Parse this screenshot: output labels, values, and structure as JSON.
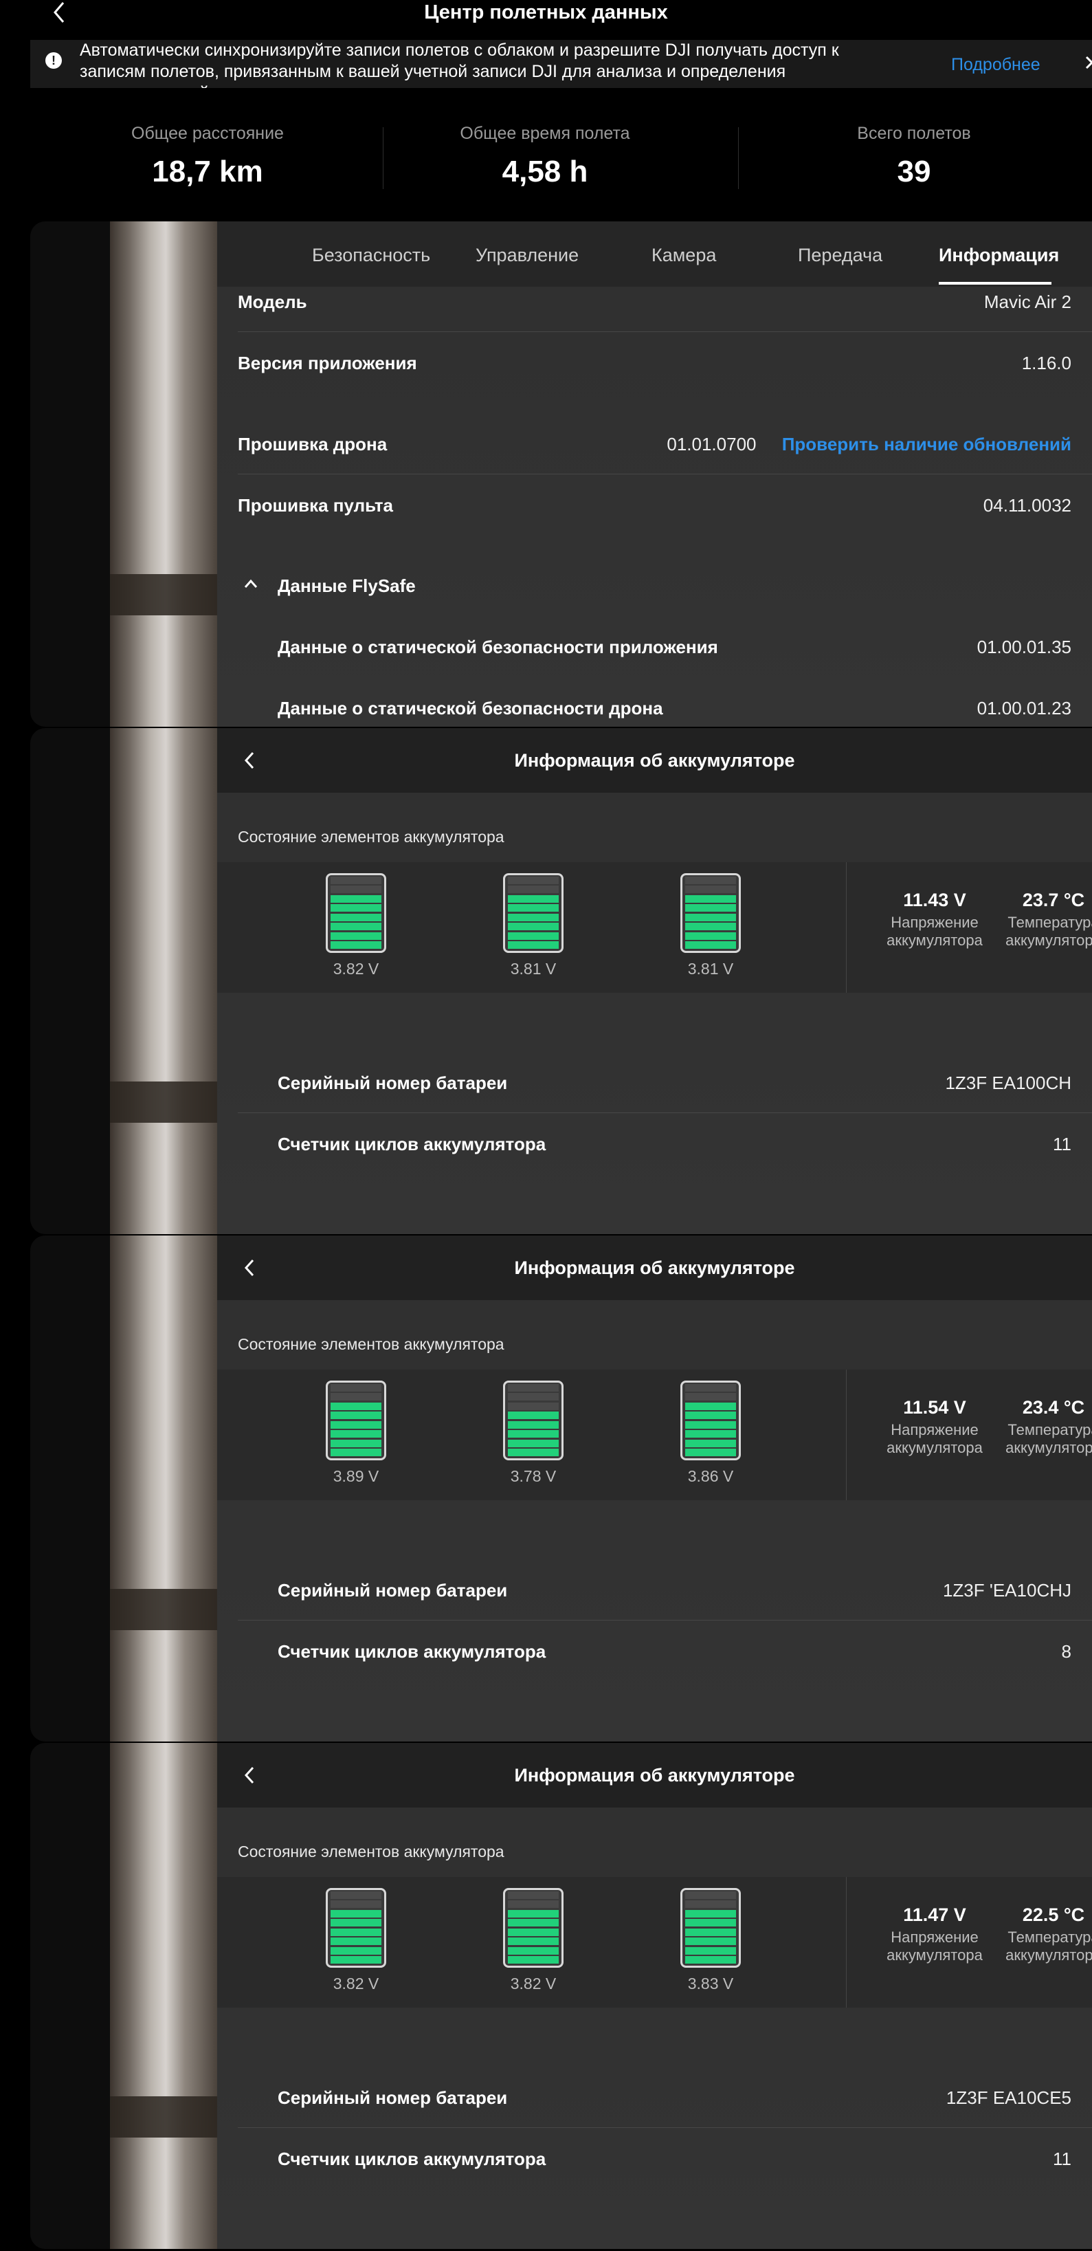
{
  "header": {
    "title": "Центр полетных данных"
  },
  "notice": {
    "text": "Автоматически синхронизируйте записи полетов с облаком и разрешите DJI получать доступ к записям полетов, привязанным к вашей учетной записи DJI для анализа и определения неисправностей",
    "more_label": "Подробнее"
  },
  "stats": [
    {
      "label": "Общее расстояние",
      "value": "18,7 km"
    },
    {
      "label": "Общее время полета",
      "value": "4,58 h"
    },
    {
      "label": "Всего полетов",
      "value": "39"
    }
  ],
  "tabs": [
    {
      "label": "Безопасность"
    },
    {
      "label": "Управление"
    },
    {
      "label": "Камера"
    },
    {
      "label": "Передача"
    },
    {
      "label": "Информация",
      "active": true
    }
  ],
  "info": {
    "model_label": "Модель",
    "model_value": "Mavic Air 2",
    "app_version_label": "Версия приложения",
    "app_version_value": "1.16.0",
    "drone_fw_label": "Прошивка дрона",
    "drone_fw_value": "01.01.0700",
    "check_updates_label": "Проверить наличие обновлений",
    "rc_fw_label": "Прошивка пульта",
    "rc_fw_value": "04.11.0032",
    "flysafe_label": "Данные FlySafe",
    "app_static_label": "Данные о статической безопасности приложения",
    "app_static_value": "01.00.01.35",
    "drone_static_label": "Данные о статической безопасности дрона",
    "drone_static_value": "01.00.01.23"
  },
  "battery_common": {
    "title": "Информация об аккумуляторе",
    "cells_label": "Состояние элементов аккумулятора",
    "voltage_label_1": "Напряжение",
    "voltage_label_2": "аккумулятора",
    "temp_label_1": "Температура",
    "temp_label_2": "аккумулятора",
    "serial_label": "Серийный номер батареи",
    "cycles_label": "Счетчик циклов аккумулятора"
  },
  "batteries": [
    {
      "cells": [
        "3.82 V",
        "3.81 V",
        "3.81 V"
      ],
      "cell_levels": [
        0.75,
        0.75,
        0.75
      ],
      "voltage": "11.43 V",
      "temperature": "23.7 °C",
      "serial": "1Z3F      EA100CH",
      "cycles": "11"
    },
    {
      "cells": [
        "3.89 V",
        "3.78 V",
        "3.86 V"
      ],
      "cell_levels": [
        0.75,
        0.62,
        0.75
      ],
      "voltage": "11.54 V",
      "temperature": "23.4 °C",
      "serial": "1Z3F       'EA10CHJ",
      "cycles": "8"
    },
    {
      "cells": [
        "3.82 V",
        "3.82 V",
        "3.83 V"
      ],
      "cell_levels": [
        0.75,
        0.75,
        0.75
      ],
      "voltage": "11.47 V",
      "temperature": "22.5 °C",
      "serial": "1Z3F       EA10CE5",
      "cycles": "11"
    }
  ],
  "colors": {
    "accent": "#2d8fe8",
    "cell_fill": "#21d07a",
    "cell_empty": "#4a4a4a"
  }
}
